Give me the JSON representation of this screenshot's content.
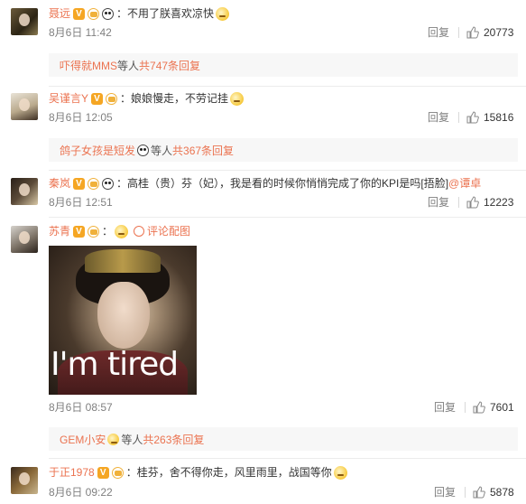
{
  "comments": [
    {
      "username": "聂远",
      "text": "：不用了朕喜欢凉快",
      "date": "8月6日 11:42",
      "reply_label": "回复",
      "likes": "20773",
      "subreply": {
        "who": "吓得就MMS",
        "mid": " 等人 ",
        "total": "共747条回复"
      }
    },
    {
      "username": "吴谨言Y",
      "text": "：娘娘慢走，不劳记挂",
      "date": "8月6日 12:05",
      "reply_label": "回复",
      "likes": "15816",
      "subreply": {
        "who": "鸽子女孩是短发",
        "mid": " 等人 ",
        "total": "共367条回复"
      }
    },
    {
      "username": "秦岚",
      "text": "：高桂（贵）芬（妃），我是看的时候你悄悄完成了你的KPI是吗[捂脸]",
      "mention": "@谭卓",
      "date": "8月6日 12:51",
      "reply_label": "回复",
      "likes": "12223"
    },
    {
      "username": "苏青",
      "text": "：",
      "pic_tag": "评论配图",
      "image_caption": "I'm tired",
      "date": "8月6日 08:57",
      "reply_label": "回复",
      "likes": "7601",
      "subreply": {
        "who": "GEM小安",
        "mid": " 等人 ",
        "total": "共263条回复"
      }
    },
    {
      "username": "于正1978",
      "text": "：桂芬，舍不得你走，风里雨里，战国等你",
      "date": "8月6日 09:22",
      "reply_label": "回复",
      "likes": "5878"
    }
  ],
  "colors": {
    "accent": "#eb7350",
    "meta": "#808080",
    "subreply_bg": "#f7f7f7"
  },
  "icons": [
    "vip-v-icon",
    "crown-badge-icon",
    "panda-badge-icon",
    "emoji-icon",
    "thumbs-up-icon",
    "picture-icon"
  ]
}
